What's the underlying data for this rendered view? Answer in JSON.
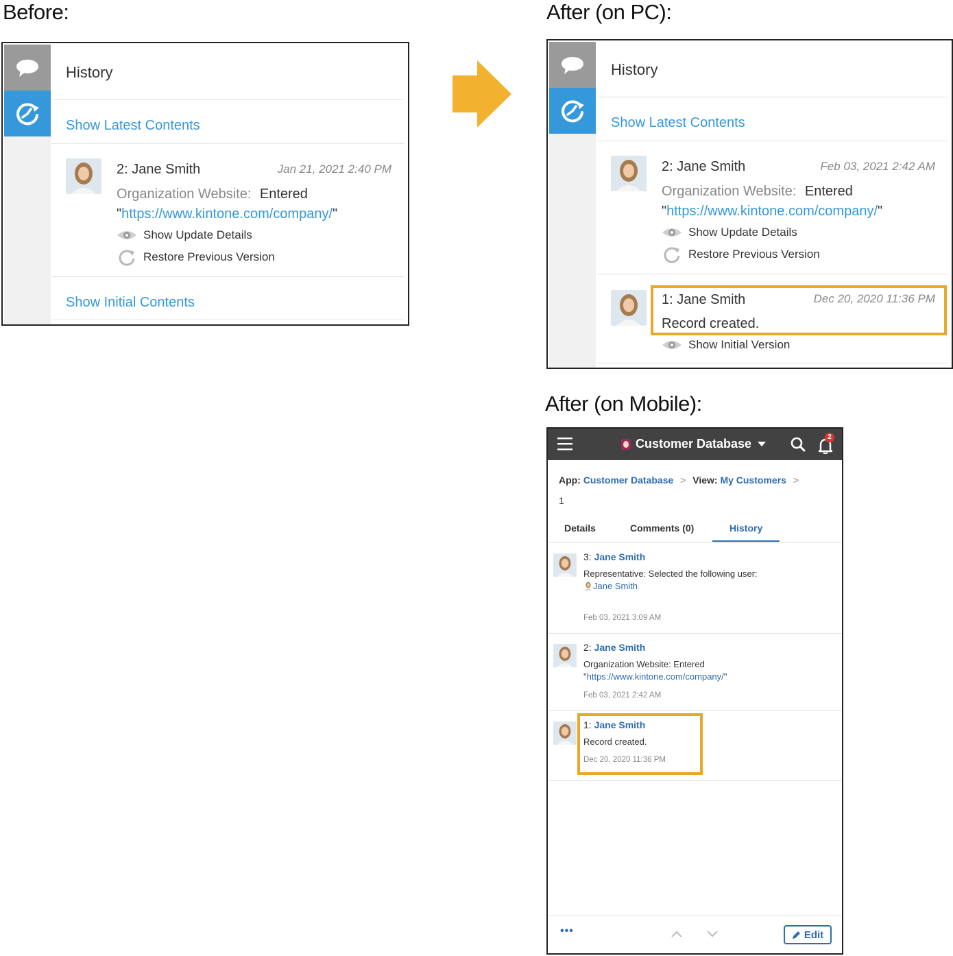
{
  "labels": {
    "before": "Before:",
    "after_pc": "After (on PC):",
    "after_mobile": "After (on Mobile):"
  },
  "colors": {
    "link": "#3498db",
    "highlight": "#e8a92b",
    "arrow": "#f2b22f",
    "sidebar_active": "#3498db",
    "sidebar_inactive": "#9a9a9a",
    "mobile_topbar": "#424242"
  },
  "icons": {
    "comment": "speech-bubble-icon",
    "history": "clock-history-icon",
    "eye": "eye-icon",
    "restore": "refresh-icon",
    "arrow": "right-arrow-icon",
    "menu": "hamburger-menu-icon",
    "search": "search-icon",
    "bell": "bell-icon",
    "edit": "pencil-icon",
    "more": "more-dots-icon"
  },
  "before": {
    "title": "History",
    "show_latest": "Show Latest Contents",
    "entry": {
      "number": "2: ",
      "user": "Jane Smith",
      "date": "Jan 21, 2021 2:40 PM",
      "field_label": "Organization Website:",
      "field_value": "Entered",
      "url": "https://www.kintone.com/company/",
      "quote": "\"",
      "show_details": "Show Update Details",
      "restore": "Restore Previous Version"
    },
    "show_initial": "Show Initial Contents"
  },
  "after_pc": {
    "title": "History",
    "show_latest": "Show Latest Contents",
    "entry2": {
      "number": "2: ",
      "user": "Jane Smith",
      "date": "Feb 03, 2021 2:42 AM",
      "field_label": "Organization Website:",
      "field_value": "Entered",
      "url": "https://www.kintone.com/company/",
      "quote": "\"",
      "show_details": "Show Update Details",
      "restore": "Restore Previous Version"
    },
    "entry1": {
      "number": "1: ",
      "user": "Jane Smith",
      "date": "Dec 20, 2020 11:36 PM",
      "text": "Record created.",
      "show_initial": "Show Initial Version"
    }
  },
  "mobile": {
    "app_title": "Customer Database",
    "notification_count": "2",
    "breadcrumb": {
      "app_label": "App:",
      "app_name": "Customer Database",
      "sep": ">",
      "view_label": "View:",
      "view_name": "My Customers",
      "record_id": "1"
    },
    "tabs": [
      "Details",
      "Comments (0)",
      "History"
    ],
    "active_tab": "History",
    "entries": [
      {
        "number": "3: ",
        "user": "Jane Smith",
        "line1": "Representative: Selected the following user:",
        "selected_user": "Jane Smith",
        "date": "Feb 03, 2021 3:09 AM"
      },
      {
        "number": "2: ",
        "user": "Jane Smith",
        "line1": "Organization Website: Entered",
        "quote": "\"",
        "url": "https://www.kintone.com/company/",
        "date": "Feb 03, 2021 2:42 AM"
      },
      {
        "number": "1: ",
        "user": "Jane Smith",
        "line1": "Record created.",
        "date": "Dec 20, 2020 11:36 PM"
      }
    ],
    "footer": {
      "more": "•••",
      "edit": "Edit"
    }
  }
}
